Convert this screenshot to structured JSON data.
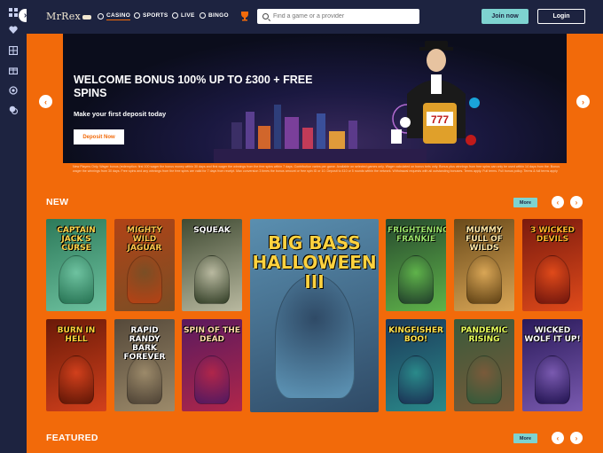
{
  "nav": {
    "logo": "MrRex",
    "links": [
      {
        "label": "CASINO",
        "icon": "casino-icon"
      },
      {
        "label": "SPORTS",
        "icon": "sports-icon"
      },
      {
        "label": "LIVE",
        "icon": "live-icon"
      },
      {
        "label": "BINGO",
        "icon": "bingo-icon"
      }
    ],
    "promo_icon": "trophy-icon",
    "search_placeholder": "Find a game or a provider",
    "join_label": "Join now",
    "login_label": "Login"
  },
  "sidebar": {
    "toggle": "›",
    "icons": [
      "grid-icon",
      "heart-icon",
      "lobby-icon",
      "gift-icon",
      "support-icon",
      "chat-icon"
    ]
  },
  "hero": {
    "title": "WELCOME BONUS 100% UP TO £300 + FREE SPINS",
    "subtitle": "Make your first deposit today",
    "cta": "Deposit Now",
    "prev": "‹",
    "next": "›",
    "terms": "New Players Only. Wager bonus (redemption: first 100 wager the bonus money within 30 days and first wager the winnings from the free spins within 7 days. Contribution varies per game. Available on selected games only. Wager calculated on bonus bets only. Bonus plus winnings from free spins can only be used within 14 days from the. Bonus wager the winnings from 30 days. Free spins and any winnings from the free spins are valid for 7 days from receipt. Max conversion 3 times the bonus amount or free spin ID or 10. Deposit to £10 or 5 rounds within the network. Withdrawal requests with all outstanding bonuses. Terms apply. Full terms. Full bonus policy. Terms & full terms apply"
  },
  "sections": {
    "new": {
      "title": "NEW",
      "more": "More",
      "prev": "‹",
      "next": "›"
    },
    "featured": {
      "title": "FEATURED",
      "more": "More",
      "prev": "‹",
      "next": "›"
    }
  },
  "games": [
    {
      "name": "CAPTAIN JACK'S CURSE",
      "bg": "#2d7a5a",
      "fg": "#6ec2a0",
      "text": "#ffd44a"
    },
    {
      "name": "MIGHTY WILD JAGUAR",
      "bg": "#b14316",
      "fg": "#7a4e25",
      "text": "#ffc64a"
    },
    {
      "name": "SQUEAK",
      "bg": "#3f4a32",
      "fg": "#b9b9a0",
      "text": "#ffffff"
    },
    {
      "name": "BIG BASS HALLOWEEN III",
      "bg": "#5a8fb0",
      "fg": "#2f4a66",
      "text": "#ffd23f"
    },
    {
      "name": "FRIGHTENING FRANKIE",
      "bg": "#274a2e",
      "fg": "#5fb34a",
      "text": "#9ae26a"
    },
    {
      "name": "MUMMY FULL OF WILDS",
      "bg": "#6a4a1a",
      "fg": "#d9a656",
      "text": "#ffe8a8"
    },
    {
      "name": "3 WICKED DEVILS",
      "bg": "#7a1a0e",
      "fg": "#e04a1a",
      "text": "#ffb42a"
    },
    {
      "name": "BURN IN HELL",
      "bg": "#6a1a08",
      "fg": "#d2401c",
      "text": "#ffd33a"
    },
    {
      "name": "RAPID RANDY BARK FOREVER",
      "bg": "#55493a",
      "fg": "#9c8a6a",
      "text": "#ffffff"
    },
    {
      "name": "SPIN OF THE DEAD",
      "bg": "#5a1a5e",
      "fg": "#b0264a",
      "text": "#ffd9a8"
    },
    {
      "name": "KINGFISHER BOO!",
      "bg": "#1c3a5a",
      "fg": "#2a8a8a",
      "text": "#ffe04a"
    },
    {
      "name": "PANDEMIC RISING",
      "bg": "#3a5a3a",
      "fg": "#7a5a3a",
      "text": "#e8ff5a"
    },
    {
      "name": "WICKED WOLF IT UP!",
      "bg": "#2a1a5a",
      "fg": "#7a5ab0",
      "text": "#ffffff"
    }
  ]
}
